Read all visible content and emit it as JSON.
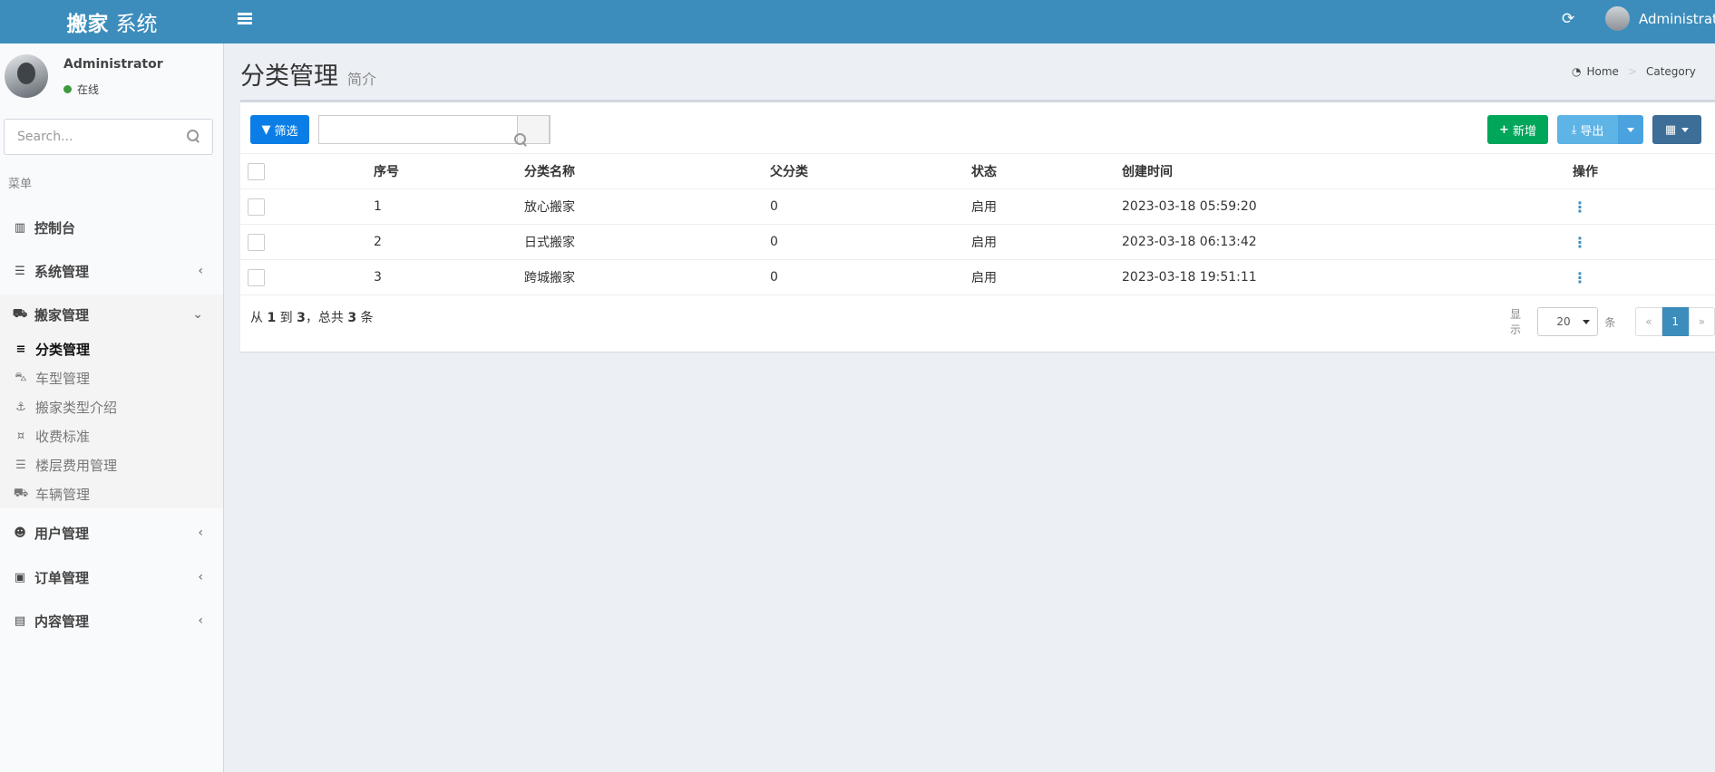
{
  "header": {
    "brand_bold": "搬家",
    "brand_rest": "系统",
    "user_name": "Administrator",
    "menu_icon": "bars-icon",
    "refresh_icon": "refresh-icon"
  },
  "sidebar": {
    "user_name": "Administrator",
    "status": "在线",
    "search_placeholder": "Search...",
    "menu_header": "菜单",
    "items": [
      {
        "label": "控制台",
        "icon": "bar-chart-icon"
      },
      {
        "label": "系统管理",
        "icon": "server-icon"
      },
      {
        "label": "搬家管理",
        "icon": "cart-icon"
      },
      {
        "label": "用户管理",
        "icon": "users-icon"
      },
      {
        "label": "订单管理",
        "icon": "briefcase-icon"
      },
      {
        "label": "内容管理",
        "icon": "newspaper-icon"
      }
    ],
    "subitems": [
      {
        "label": "分类管理",
        "icon": "list-icon"
      },
      {
        "label": "车型管理",
        "icon": "car-icon"
      },
      {
        "label": "搬家类型介绍",
        "icon": "anchor-icon"
      },
      {
        "label": "收费标准",
        "icon": "money-icon"
      },
      {
        "label": "楼层费用管理",
        "icon": "align-center-icon"
      },
      {
        "label": "车辆管理",
        "icon": "ambulance-icon"
      }
    ]
  },
  "page": {
    "title": "分类管理",
    "subtitle": "简介",
    "breadcrumb": [
      "Home",
      "Category"
    ]
  },
  "toolbar": {
    "filter": "筛选",
    "add": "新增",
    "export": "导出"
  },
  "table": {
    "columns": [
      "序号",
      "分类名称",
      "父分类",
      "状态",
      "创建时间",
      "操作"
    ],
    "rows": [
      [
        "1",
        "放心搬家",
        "0",
        "启用",
        "2023-03-18 05:59:20"
      ],
      [
        "2",
        "日式搬家",
        "0",
        "启用",
        "2023-03-18 06:13:42"
      ],
      [
        "3",
        "跨城搬家",
        "0",
        "启用",
        "2023-03-18 19:51:11"
      ]
    ]
  },
  "footer": {
    "info_prefix": "从",
    "from": "1",
    "to_word": "到",
    "to": "3",
    "total_prefix": "，总共",
    "total": "3",
    "total_suffix": "条",
    "show": "显示",
    "per_page": "20",
    "per_unit": "条",
    "prev": "«",
    "page": "1",
    "next": "»"
  },
  "colors": {
    "header": "#3c8dbc",
    "add_button": "#00a65a",
    "filter_button": "#0a7ee6"
  }
}
